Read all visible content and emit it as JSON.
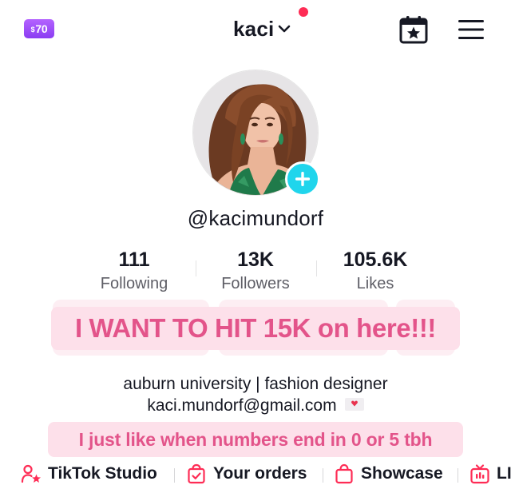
{
  "header": {
    "coin_badge_prefix": "$",
    "coin_badge_value": "70",
    "account_name": "kaci",
    "icons": {
      "switch_account": "chevron-down-icon",
      "calendar": "calendar-star-icon",
      "menu": "hamburger-menu-icon"
    },
    "colors": {
      "coin_badge": "#9b4dff",
      "notification_dot": "#fe2c55"
    }
  },
  "profile": {
    "username": "@kacimundorf",
    "add_button_icon": "plus-icon",
    "add_button_color": "#20d5ec"
  },
  "stats": [
    {
      "value": "111",
      "label": "Following"
    },
    {
      "value": "13K",
      "label": "Followers"
    },
    {
      "value": "105.6K",
      "label": "Likes"
    }
  ],
  "overlay": {
    "headline": "I WANT TO HIT 15K on here!!!",
    "footnote": "I just like when numbers end in 0 or 5 tbh",
    "text_color": "#e3548a",
    "background_color": "#fde0ea"
  },
  "bio": {
    "line1": "auburn university | fashion designer",
    "email": "kaci.mundorf@gmail.com",
    "email_icon": "love-letter-icon"
  },
  "tools": [
    {
      "label": "TikTok Studio",
      "icon": "creator-studio-icon"
    },
    {
      "label": "Your orders",
      "icon": "orders-bag-icon"
    },
    {
      "label": "Showcase",
      "icon": "shopping-bag-icon"
    },
    {
      "label": "LI",
      "icon": "live-tv-icon"
    }
  ]
}
